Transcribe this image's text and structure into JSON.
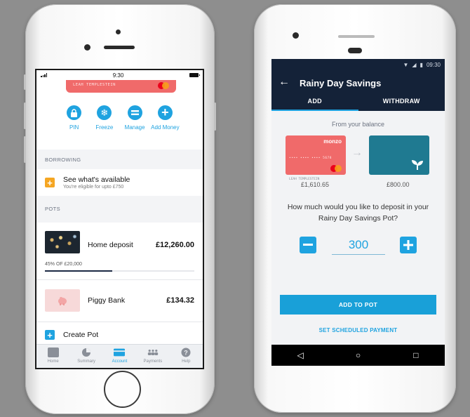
{
  "ios": {
    "status": {
      "time": "9:30"
    },
    "card_holder": "LEAH TEMPLESTEIN",
    "actions": [
      {
        "label": "PIN",
        "icon": "lock-icon"
      },
      {
        "label": "Freeze",
        "icon": "snowflake-icon"
      },
      {
        "label": "Manage",
        "icon": "manage-icon"
      },
      {
        "label": "Add Money",
        "icon": "plus-icon"
      }
    ],
    "borrowing": {
      "section_title": "BORROWING",
      "title": "See what's available",
      "subtitle": "You're eligible for upto £750"
    },
    "pots": {
      "section_title": "POTS",
      "items": [
        {
          "name": "Home deposit",
          "value": "£12,260.00",
          "progress_label": "45% OF £20,000",
          "progress": 0.45
        },
        {
          "name": "Piggy Bank",
          "value": "£134.32"
        }
      ],
      "create_label": "Create Pot"
    },
    "tabs": [
      {
        "label": "Home",
        "icon": "home-icon"
      },
      {
        "label": "Summary",
        "icon": "pie-chart-icon"
      },
      {
        "label": "Account",
        "icon": "card-icon"
      },
      {
        "label": "Payments",
        "icon": "people-icon"
      },
      {
        "label": "Help",
        "icon": "help-icon"
      }
    ],
    "colors": {
      "accent": "#1fa3e0",
      "borrow_icon": "#f5a623",
      "card": "#f06a6a"
    }
  },
  "android": {
    "status": {
      "time": "09:30"
    },
    "title": "Rainy Day Savings",
    "tabs": [
      {
        "label": "ADD"
      },
      {
        "label": "WITHDRAW"
      }
    ],
    "from_label": "From your balance",
    "card": {
      "brand": "monzo",
      "number": "•••• •••• •••• 5678",
      "holder": "LEAH TEMPLESTEIN"
    },
    "balance": "£1,610.65",
    "pot_balance": "£800.00",
    "question": "How much would you like to deposit in your Rainy Day Savings Pot?",
    "amount": "300",
    "add_button": "ADD TO POT",
    "scheduled_link": "SET SCHEDULED PAYMENT",
    "colors": {
      "appbar": "#142238",
      "pot_card": "#1f7a91",
      "accent": "#1fa3e0"
    }
  }
}
